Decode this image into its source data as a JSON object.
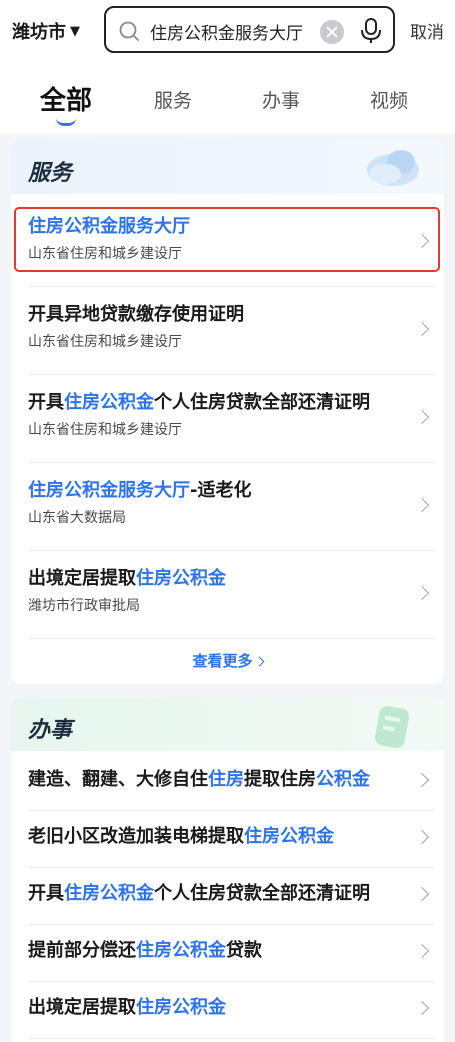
{
  "topbar": {
    "city": "潍坊市",
    "city_dropdown_icon": "triangle-down-icon",
    "search_value": "住房公积金服务大厅",
    "cancel_label": "取消"
  },
  "tabs": [
    {
      "label": "全部",
      "active": true
    },
    {
      "label": "服务",
      "active": false
    },
    {
      "label": "办事",
      "active": false
    },
    {
      "label": "视频",
      "active": false
    }
  ],
  "services": {
    "title": "服务",
    "items": [
      {
        "title_parts": [
          {
            "text": "住房公积金服务大厅",
            "hl": true
          }
        ],
        "source": "山东省住房和城乡建设厅",
        "highlighted_box": true
      },
      {
        "title_parts": [
          {
            "text": "开具异地贷款缴存使用证明",
            "hl": false
          }
        ],
        "source": "山东省住房和城乡建设厅"
      },
      {
        "title_parts": [
          {
            "text": "开具",
            "hl": false
          },
          {
            "text": "住房公积金",
            "hl": true
          },
          {
            "text": "个人住房贷款全部还清证明",
            "hl": false
          }
        ],
        "source": "山东省住房和城乡建设厅"
      },
      {
        "title_parts": [
          {
            "text": "住房公积金服务大厅",
            "hl": true
          },
          {
            "text": "-适老化",
            "hl": false
          }
        ],
        "source": "山东省大数据局"
      },
      {
        "title_parts": [
          {
            "text": "出境定居提取",
            "hl": false
          },
          {
            "text": "住房公积金",
            "hl": true
          }
        ],
        "source": "潍坊市行政审批局"
      }
    ],
    "more_label": "查看更多"
  },
  "affairs": {
    "title": "办事",
    "items": [
      {
        "title_parts": [
          {
            "text": "建造、翻建、大修自住",
            "hl": false
          },
          {
            "text": "住房",
            "hl": true
          },
          {
            "text": "提取住房",
            "hl": false
          },
          {
            "text": "公积金",
            "hl": true
          }
        ]
      },
      {
        "title_parts": [
          {
            "text": "老旧小区改造加装电梯提取",
            "hl": false
          },
          {
            "text": "住房公积金",
            "hl": true
          }
        ]
      },
      {
        "title_parts": [
          {
            "text": "开具",
            "hl": false
          },
          {
            "text": "住房公积金",
            "hl": true
          },
          {
            "text": "个人住房贷款全部还清证明",
            "hl": false
          }
        ]
      },
      {
        "title_parts": [
          {
            "text": "提前部分偿还",
            "hl": false
          },
          {
            "text": "住房公积金",
            "hl": true
          },
          {
            "text": "贷款",
            "hl": false
          }
        ]
      },
      {
        "title_parts": [
          {
            "text": "出境定居提取",
            "hl": false
          },
          {
            "text": "住房公积金",
            "hl": true
          }
        ]
      }
    ]
  },
  "colors": {
    "accent": "#2f74e6",
    "highlight_box": "#e23b2e"
  }
}
